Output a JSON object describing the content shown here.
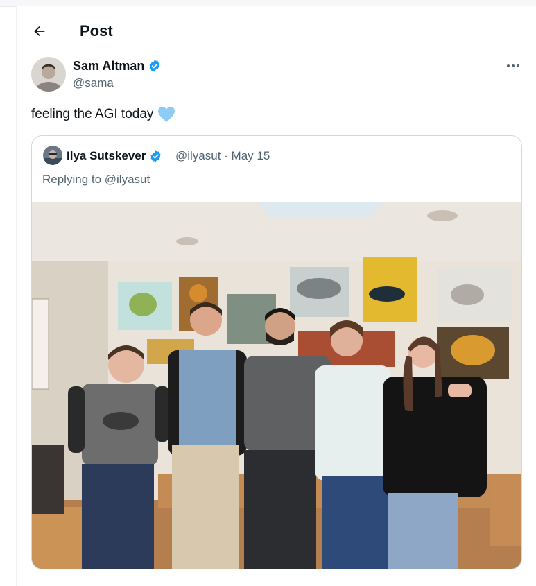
{
  "header": {
    "title": "Post",
    "back_icon": "arrow-left-icon"
  },
  "post": {
    "author": {
      "name": "Sam Altman",
      "handle": "@sama",
      "verified": true
    },
    "text": "feeling the AGI today",
    "emoji": "💙",
    "more_icon": "ellipsis-icon"
  },
  "quote": {
    "author": {
      "name": "Ilya Sutskever",
      "verified": true
    },
    "meta": "@ilyasut · May 15",
    "reply": "Replying to @ilyasut"
  },
  "colors": {
    "verified_badge": "#1d9bf0",
    "secondary_text": "#536471",
    "border": "#cfd9de"
  }
}
